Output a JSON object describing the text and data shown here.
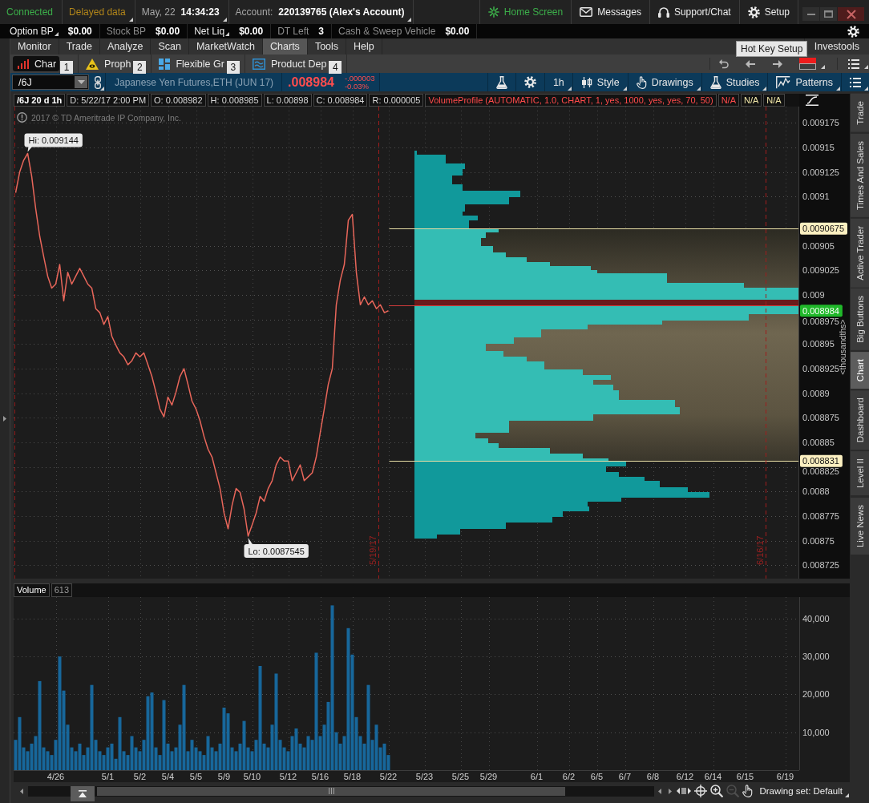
{
  "status_bar": {
    "cells": [
      {
        "kind": "connection",
        "value": "Connected"
      },
      {
        "kind": "feed",
        "value": "Delayed data"
      },
      {
        "kind": "clock",
        "label": "May, 22",
        "value": "14:34:23"
      },
      {
        "kind": "account",
        "label": "Account:",
        "value": "220139765 (Alex's Account)"
      }
    ],
    "links": [
      {
        "kind": "home",
        "label": "Home Screen"
      },
      {
        "kind": "messages",
        "label": "Messages"
      },
      {
        "kind": "support",
        "label": "Support/Chat"
      },
      {
        "kind": "setup",
        "label": "Setup"
      }
    ]
  },
  "balances": [
    {
      "label": "Option BP",
      "value": "$0.00",
      "dropdown": true
    },
    {
      "label": "Stock BP",
      "value": "$0.00",
      "dropdown": false
    },
    {
      "label": "Net Liq",
      "value": "$0.00",
      "dropdown": true
    },
    {
      "label": "DT Left",
      "value": "3",
      "dropdown": false
    },
    {
      "label": "Cash & Sweep Vehicle",
      "value": "$0.00",
      "dropdown": false
    }
  ],
  "main_tabs": [
    {
      "label": "Monitor",
      "selected": false
    },
    {
      "label": "Trade",
      "selected": false
    },
    {
      "label": "Analyze",
      "selected": false
    },
    {
      "label": "Scan",
      "selected": false
    },
    {
      "label": "MarketWatch",
      "selected": false
    },
    {
      "label": "Charts",
      "selected": true
    },
    {
      "label": "Tools",
      "selected": false
    },
    {
      "label": "Help",
      "selected": false
    }
  ],
  "investools_tab": "Investools",
  "sub_tabs": [
    {
      "kind": "charts",
      "label": "Char",
      "hotkey": "1",
      "selected": true
    },
    {
      "kind": "prophet",
      "label": "Proph",
      "hotkey": "2",
      "selected": false
    },
    {
      "kind": "grid",
      "label": "Flexible Gr",
      "hotkey": "3",
      "selected": false
    },
    {
      "kind": "depth",
      "label": "Product Dep",
      "hotkey": "4",
      "selected": false
    }
  ],
  "tooltip": "Hot Key Setup",
  "symbol_bar": {
    "symbol": "/6J",
    "description": "Japanese Yen Futures,ETH (JUN 17)",
    "last": ".008984",
    "change": "-.000003",
    "change_percent": "-0.03%",
    "negative": true,
    "buttons": [
      {
        "kind": "aggregation",
        "label": "1h"
      },
      {
        "kind": "style",
        "label": "Style"
      },
      {
        "kind": "drawings",
        "label": "Drawings"
      },
      {
        "kind": "studies",
        "label": "Studies"
      },
      {
        "kind": "patterns",
        "label": "Patterns"
      }
    ]
  },
  "price_chart": {
    "legend": [
      {
        "kind": "title",
        "text": "/6J 20 d 1h"
      },
      {
        "kind": "field",
        "text": "D: 5/22/17 2:00 PM"
      },
      {
        "kind": "field",
        "text": "O: 0.008982"
      },
      {
        "kind": "field",
        "text": "H: 0.008985"
      },
      {
        "kind": "field",
        "text": "L: 0.00898"
      },
      {
        "kind": "field",
        "text": "C: 0.008984"
      },
      {
        "kind": "field",
        "text": "R: 0.000005"
      },
      {
        "kind": "study",
        "text": "VolumeProfile (AUTOMATIC, 1.0, CHART, 1, yes, 1000, yes, yes, 70, 50)"
      },
      {
        "kind": "study",
        "text": "N/A"
      },
      {
        "kind": "level",
        "text": "N/A"
      },
      {
        "kind": "level",
        "text": "N/A"
      }
    ],
    "copyright": "2017 © TD Ameritrade IP Company, Inc.",
    "period_markers": [
      "5/19/17",
      "6/16/17"
    ],
    "chart_data": {
      "type": "line",
      "grid": true,
      "ylabel": "<thousandths>",
      "categories": [
        null,
        null,
        null,
        null,
        null,
        null,
        null,
        null,
        null,
        null,
        null,
        null,
        null,
        null,
        null,
        null,
        null,
        null,
        null,
        null,
        null,
        null,
        null,
        null,
        null,
        null,
        null,
        null,
        null,
        null,
        null,
        null,
        null,
        null,
        null,
        null,
        null,
        null,
        null,
        null,
        null,
        null,
        null,
        null,
        null,
        null,
        null,
        null,
        null,
        null,
        null,
        null,
        null,
        null,
        null,
        null,
        null,
        null,
        null,
        null,
        null,
        null,
        null,
        null,
        null,
        null,
        null,
        null,
        null,
        null,
        null,
        null,
        null,
        null,
        null,
        null,
        null,
        null,
        null,
        null,
        null,
        null,
        null,
        null,
        null,
        null,
        null,
        null,
        null,
        null,
        null,
        null,
        null,
        null,
        null,
        null,
        null,
        null,
        null,
        null,
        null,
        null,
        null,
        null,
        null,
        null,
        null,
        null,
        null,
        null,
        null,
        null,
        null,
        null,
        null,
        null,
        null,
        null,
        null,
        null,
        null,
        null,
        null,
        null,
        null,
        null,
        null,
        null,
        null,
        null,
        null,
        null,
        null,
        null,
        null,
        null,
        null,
        null,
        null,
        null,
        null,
        null,
        null,
        null,
        null,
        null,
        null,
        null,
        null,
        null,
        null,
        null,
        null,
        null,
        null,
        null,
        null,
        null,
        null,
        null,
        null,
        null,
        null,
        null,
        null,
        null,
        null,
        null,
        null,
        null,
        null,
        null,
        null,
        null,
        null,
        null,
        null,
        null,
        null,
        null,
        null,
        null,
        null,
        null,
        null,
        null,
        null,
        null,
        null,
        null,
        null,
        null,
        null,
        null,
        null,
        null
      ],
      "series": [
        {
          "color": "#e8665a",
          "values": [
            0.009104,
            0.009125,
            0.009137,
            0.009144,
            0.009121,
            0.009088,
            0.00906,
            0.009039,
            0.009019,
            0.009007,
            0.009011,
            0.009031,
            0.008994,
            0.009023,
            0.009011,
            0.009019,
            0.009027,
            0.009019,
            0.009011,
            0.009007,
            0.008986,
            0.008982,
            0.00897,
            0.008978,
            0.008958,
            0.008949,
            0.008941,
            0.008937,
            0.008929,
            0.008933,
            0.008941,
            0.008937,
            0.008941,
            0.008929,
            0.008917,
            0.008901,
            0.008884,
            0.008876,
            0.008896,
            0.008888,
            0.008901,
            0.008917,
            0.008925,
            0.008909,
            0.008892,
            0.008884,
            0.008872,
            0.008856,
            0.008843,
            0.008835,
            0.008819,
            0.008803,
            0.008778,
            0.008762,
            0.008786,
            0.008803,
            0.008799,
            0.008782,
            0.0087545,
            0.008766,
            0.008778,
            0.008795,
            0.00879,
            0.008803,
            0.008811,
            0.008827,
            0.008835,
            0.008831,
            0.008831,
            0.008811,
            0.008819,
            0.008827,
            0.008811,
            0.008815,
            0.008819,
            0.008835,
            0.00886,
            0.008884,
            0.008909,
            0.008925,
            0.00899,
            0.009015,
            0.009031,
            0.009076,
            0.009082,
            0.009023,
            0.00899,
            0.008998,
            0.00899,
            0.008994,
            0.008986,
            0.00899,
            0.008982,
            0.008984,
            null,
            null,
            null,
            null,
            null,
            null,
            null,
            null,
            null,
            null,
            null,
            null,
            null,
            null,
            null,
            null,
            null,
            null,
            null,
            null,
            null,
            null,
            null,
            null,
            null,
            null,
            null,
            null,
            null,
            null,
            null,
            null,
            null,
            null,
            null,
            null,
            null,
            null,
            null,
            null,
            null,
            null,
            null,
            null,
            null,
            null,
            null,
            null,
            null,
            null,
            null,
            null,
            null,
            null,
            null,
            null,
            null,
            null,
            null,
            null,
            null,
            null,
            null,
            null,
            null,
            null,
            null,
            null,
            null,
            null,
            null,
            null,
            null,
            null,
            null,
            null,
            null,
            null,
            null,
            null,
            null,
            null,
            null,
            null,
            null,
            null,
            null,
            null,
            null,
            null,
            null,
            null,
            null,
            null,
            null,
            null,
            null,
            null,
            null,
            null,
            null,
            null
          ]
        }
      ],
      "ylim": [
        0.0087113,
        0.0091917
      ],
      "yticks": [
        0.008725,
        0.00875,
        0.008775,
        0.0088,
        0.008825,
        0.00885,
        0.008875,
        0.0089,
        0.008925,
        0.00895,
        0.008975,
        0.009,
        0.009025,
        0.00905,
        0.0091,
        0.009125,
        0.00915,
        0.009175
      ],
      "annotations": [
        "Hi: 0.009144",
        "Lo: 0.0087545",
        "0.008984"
      ],
      "ref_lines": [
        {
          "axis": "y",
          "value": 0.0090675,
          "label": "0.0090675"
        },
        {
          "axis": "y",
          "value": 0.008831,
          "label": "0.008831"
        }
      ]
    }
  },
  "volume_chart": {
    "legend": [
      {
        "kind": "name",
        "text": "Volume"
      },
      {
        "kind": "count",
        "text": "613"
      }
    ],
    "chart_data": {
      "type": "bar",
      "grid": true,
      "categories": [
        null,
        null,
        null,
        null,
        null,
        null,
        null,
        null,
        null,
        null,
        "4/26",
        null,
        null,
        null,
        null,
        null,
        null,
        null,
        null,
        null,
        null,
        null,
        null,
        "5/1",
        null,
        null,
        null,
        null,
        null,
        null,
        null,
        "5/2",
        null,
        null,
        null,
        null,
        null,
        null,
        "5/4",
        null,
        null,
        null,
        null,
        null,
        null,
        "5/5",
        null,
        null,
        null,
        null,
        null,
        null,
        "5/9",
        null,
        null,
        null,
        null,
        null,
        null,
        "5/10",
        null,
        null,
        null,
        null,
        null,
        null,
        null,
        null,
        "5/12",
        null,
        null,
        null,
        null,
        null,
        null,
        null,
        "5/16",
        null,
        null,
        null,
        null,
        null,
        null,
        null,
        "5/18",
        null,
        null,
        null,
        null,
        null,
        null,
        null,
        null,
        "5/22",
        null,
        null,
        null,
        null,
        null,
        null,
        null,
        null,
        "5/23",
        null,
        null,
        null,
        null,
        null,
        null,
        null,
        null,
        "5/25",
        null,
        null,
        null,
        null,
        null,
        null,
        "5/29",
        null,
        null,
        null,
        null,
        null,
        null,
        null,
        null,
        null,
        null,
        null,
        "6/1",
        null,
        null,
        null,
        null,
        null,
        null,
        null,
        "6/2",
        null,
        null,
        null,
        null,
        null,
        null,
        "6/5",
        null,
        null,
        null,
        null,
        null,
        null,
        "6/7",
        null,
        null,
        null,
        null,
        null,
        null,
        "6/8",
        null,
        null,
        null,
        null,
        null,
        null,
        null,
        "6/12",
        null,
        null,
        null,
        null,
        null,
        null,
        "6/14",
        null,
        null,
        null,
        null,
        null,
        null,
        null,
        "6/15",
        null,
        null,
        null,
        null,
        null,
        null,
        null,
        null,
        null,
        "6/19",
        null,
        null,
        null
      ],
      "series": [
        {
          "color": "#17679b",
          "values": [
            8000,
            14000,
            6000,
            5000,
            7000,
            9000,
            23500,
            6000,
            5000,
            4000,
            8000,
            30000,
            21000,
            12000,
            6000,
            5000,
            7000,
            4000,
            6000,
            22500,
            8000,
            5000,
            4000,
            6000,
            7000,
            3000,
            14000,
            5000,
            4000,
            9000,
            6000,
            5000,
            8000,
            19500,
            20500,
            6000,
            4000,
            18500,
            7000,
            5000,
            6000,
            12000,
            22500,
            5000,
            8000,
            6000,
            5000,
            4000,
            9000,
            6000,
            5000,
            7000,
            16500,
            15000,
            6000,
            5000,
            7000,
            13000,
            6000,
            5000,
            8000,
            27500,
            7000,
            6000,
            12000,
            25500,
            8000,
            6000,
            5000,
            9000,
            11000,
            7000,
            6000,
            9000,
            8000,
            31000,
            9000,
            12000,
            18000,
            43500,
            10000,
            7000,
            9000,
            37500,
            30500,
            14000,
            9000,
            7000,
            22500,
            8000,
            12000,
            6000,
            7000,
            4000,
            null,
            null,
            null,
            null,
            null,
            null,
            null,
            null,
            null,
            null,
            null,
            null,
            null,
            null,
            null,
            null,
            null,
            null,
            null,
            null,
            null,
            null,
            null,
            null,
            null,
            null,
            null,
            null,
            null,
            null,
            null,
            null,
            null,
            null,
            null,
            null,
            null,
            null,
            null,
            null,
            null,
            null,
            null,
            null,
            null,
            null,
            null,
            null,
            null,
            null,
            null,
            null,
            null,
            null,
            null,
            null,
            null,
            null,
            null,
            null,
            null,
            null,
            null,
            null,
            null,
            null,
            null,
            null,
            null,
            null,
            null,
            null,
            null,
            null,
            null,
            null,
            null,
            null,
            null,
            null,
            null,
            null,
            null,
            null,
            null,
            null,
            null,
            null,
            null,
            null,
            null,
            null,
            null,
            null,
            null,
            null,
            null,
            null,
            null,
            null,
            null,
            null
          ]
        }
      ],
      "ylim": [
        0,
        45700
      ],
      "yticks": [
        {
          "value": 10000,
          "label": "10,000"
        },
        {
          "value": 20000,
          "label": "20,000"
        },
        {
          "value": 30000,
          "label": "30,000"
        },
        {
          "value": 40000,
          "label": "40,000"
        }
      ]
    }
  },
  "chart_tools": [
    {
      "kind": "pan",
      "disabled": false
    },
    {
      "kind": "crosshair",
      "disabled": false
    },
    {
      "kind": "zoom-in",
      "disabled": false
    },
    {
      "kind": "zoom-out",
      "disabled": true
    },
    {
      "kind": "hand",
      "disabled": false
    }
  ],
  "drawing_set": "Drawing set: Default",
  "side_tabs": [
    {
      "label": "Trade",
      "selected": false
    },
    {
      "label": "Times And Sales",
      "selected": false
    },
    {
      "label": "Active Trader",
      "selected": false
    },
    {
      "label": "Big Buttons",
      "selected": false
    },
    {
      "label": "Chart",
      "selected": true
    },
    {
      "label": "Dashboard",
      "selected": false
    },
    {
      "label": "Level II",
      "selected": false
    },
    {
      "label": "Live News",
      "selected": false
    }
  ]
}
